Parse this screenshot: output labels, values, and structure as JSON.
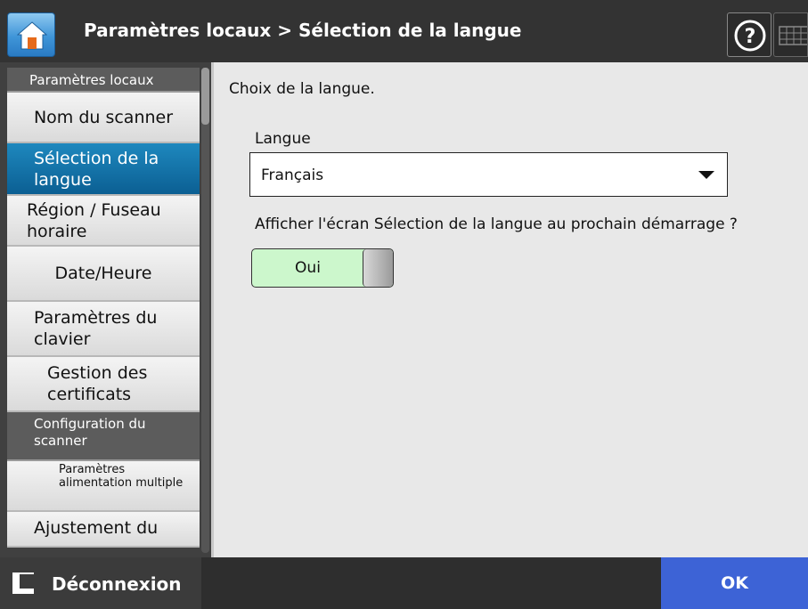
{
  "header": {
    "title": "Paramètres locaux > Sélection de la langue",
    "home_icon": "home-icon",
    "help_icon": "help-icon",
    "keyboard_icon": "keyboard-icon"
  },
  "sidebar": {
    "category_1": "Paramètres locaux",
    "items": [
      {
        "label": "Nom du scanner"
      },
      {
        "label": "Sélection de la langue",
        "selected": true
      },
      {
        "label": "Région / Fuseau horaire"
      },
      {
        "label": "Date/Heure"
      },
      {
        "label": "Paramètres du clavier"
      },
      {
        "label": "Gestion des certificats"
      }
    ],
    "category_2": "Configuration du scanner",
    "items_2": [
      {
        "label": "Paramètres alimentation multiple"
      },
      {
        "label": "Ajustement du"
      }
    ]
  },
  "main": {
    "instruction": "Choix de la langue.",
    "language_label": "Langue",
    "language_value": "Français",
    "question": "Afficher l'écran Sélection de la langue au prochain démarrage ?",
    "toggle_value": "Oui"
  },
  "footer": {
    "logout_label": "Déconnexion",
    "ok_label": "OK"
  },
  "colors": {
    "header_bg": "#333333",
    "selected_item": "#0b5f93",
    "ok_button": "#3d63d6",
    "toggle_on": "#ccf7cc"
  }
}
